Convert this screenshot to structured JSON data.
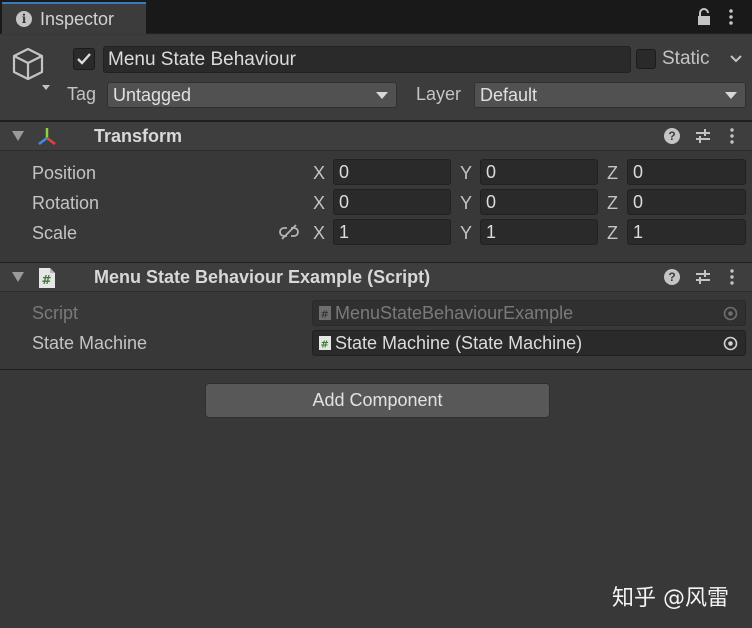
{
  "tab": {
    "label": "Inspector"
  },
  "object": {
    "name": "Menu State Behaviour",
    "active": true,
    "static_label": "Static",
    "static": false,
    "tag_label": "Tag",
    "tag_value": "Untagged",
    "layer_label": "Layer",
    "layer_value": "Default"
  },
  "transform": {
    "title": "Transform",
    "rows": [
      {
        "label": "Position",
        "x": "0",
        "y": "0",
        "z": "0"
      },
      {
        "label": "Rotation",
        "x": "0",
        "y": "0",
        "z": "0"
      },
      {
        "label": "Scale",
        "x": "1",
        "y": "1",
        "z": "1"
      }
    ],
    "axes": {
      "x": "X",
      "y": "Y",
      "z": "Z"
    }
  },
  "script_component": {
    "title": "Menu State Behaviour Example (Script)",
    "script_label": "Script",
    "script_value": "MenuStateBehaviourExample",
    "state_machine_label": "State Machine",
    "state_machine_value": "State Machine (State Machine)"
  },
  "add_component_label": "Add Component",
  "help_glyph": "?",
  "info_glyph": "i",
  "watermark": "知乎 @风雷",
  "colors": {
    "accent_tab": "#3a79bb",
    "transform_red": "#e0453a",
    "transform_green": "#8fd13f",
    "transform_blue": "#3e8ce6"
  }
}
